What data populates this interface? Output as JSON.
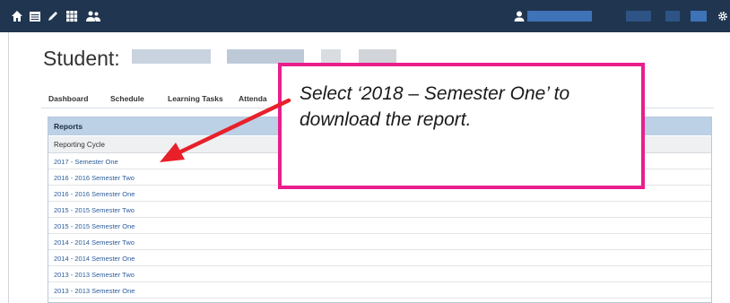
{
  "student_label": "Student:",
  "tabs": [
    {
      "label": "Dashboard"
    },
    {
      "label": "Schedule"
    },
    {
      "label": "Learning Tasks"
    },
    {
      "label": "Attenda"
    }
  ],
  "reports": {
    "title": "Reports",
    "column_header": "Reporting Cycle",
    "rows": [
      "2017 - Semester One",
      "2016 - 2016 Semester Two",
      "2016 - 2016 Semester One",
      "2015 - 2015 Semester Two",
      "2015 - 2015 Semester One",
      "2014 - 2014 Semester Two",
      "2014 - 2014 Semester One",
      "2013 - 2013 Semester Two",
      "2013 - 2013 Semester One"
    ]
  },
  "callout": {
    "text": "Select ‘2018 – Semester One’ to download the report."
  },
  "colors": {
    "topbar": "#1f3550",
    "callout_border": "#e91e8c",
    "arrow": "#e8202a",
    "link": "#2b5c9a"
  }
}
